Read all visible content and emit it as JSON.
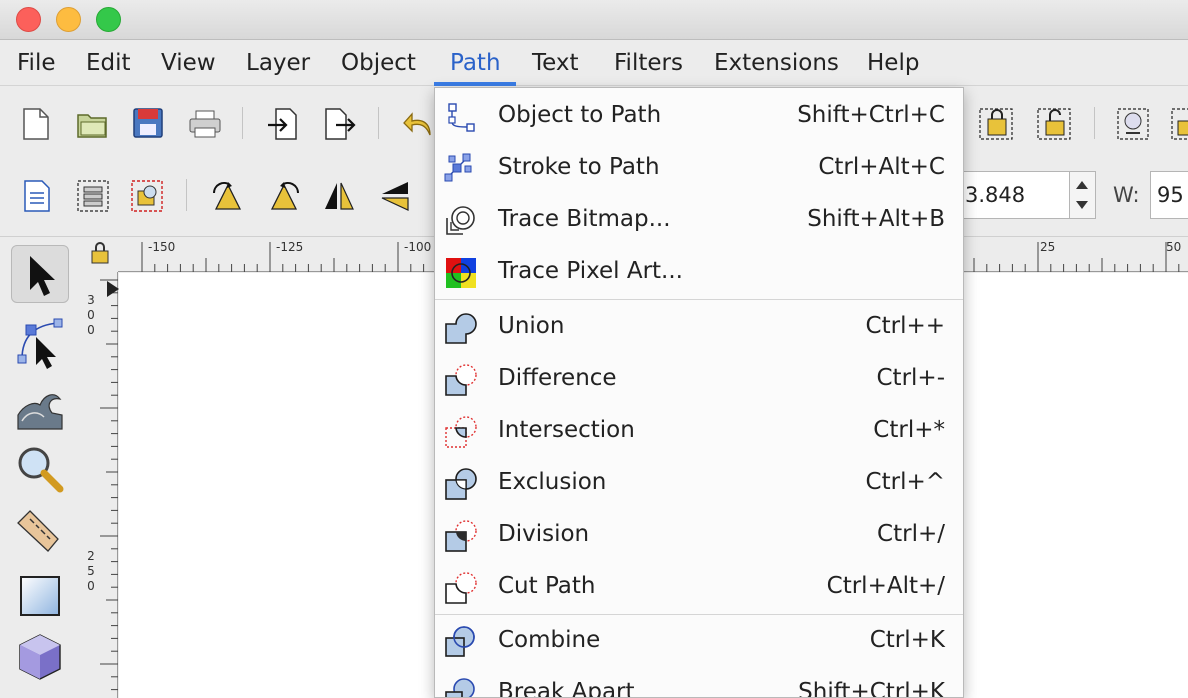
{
  "menubar": {
    "items": [
      "File",
      "Edit",
      "View",
      "Layer",
      "Object",
      "Path",
      "Text",
      "Filters",
      "Extensions",
      "Help"
    ],
    "active": "Path"
  },
  "toolbar": {
    "y_value": "3.848",
    "w_label": "W:",
    "w_value": "95"
  },
  "rulers": {
    "horizontal": [
      "-150",
      "-125",
      "-100",
      "25",
      "50"
    ],
    "vertical": [
      [
        "3",
        "0",
        "0"
      ],
      [
        "2",
        "5",
        "0"
      ]
    ]
  },
  "path_menu": {
    "groups": [
      [
        {
          "label": "Object to Path",
          "shortcut": "Shift+Ctrl+C",
          "icon": "object-to-path-icon"
        },
        {
          "label": "Stroke to Path",
          "shortcut": "Ctrl+Alt+C",
          "icon": "stroke-to-path-icon"
        },
        {
          "label": "Trace Bitmap...",
          "shortcut": "Shift+Alt+B",
          "icon": "trace-bitmap-icon"
        },
        {
          "label": "Trace Pixel Art...",
          "shortcut": "",
          "icon": "trace-pixel-art-icon"
        }
      ],
      [
        {
          "label": "Union",
          "shortcut": "Ctrl++",
          "icon": "union-icon"
        },
        {
          "label": "Difference",
          "shortcut": "Ctrl+-",
          "icon": "difference-icon"
        },
        {
          "label": "Intersection",
          "shortcut": "Ctrl+*",
          "icon": "intersection-icon"
        },
        {
          "label": "Exclusion",
          "shortcut": "Ctrl+^",
          "icon": "exclusion-icon"
        },
        {
          "label": "Division",
          "shortcut": "Ctrl+/",
          "icon": "division-icon"
        },
        {
          "label": "Cut Path",
          "shortcut": "Ctrl+Alt+/",
          "icon": "cut-path-icon"
        }
      ],
      [
        {
          "label": "Combine",
          "shortcut": "Ctrl+K",
          "icon": "combine-icon"
        },
        {
          "label": "Break Apart",
          "shortcut": "Shift+Ctrl+K",
          "icon": "break-apart-icon"
        }
      ]
    ]
  },
  "colors": {
    "accent": "#3b7ee8",
    "menu_active_text": "#2a62c9",
    "shape_fill": "#b4cbe6",
    "shape_stroke": "#1d1d1d",
    "cut_stroke": "#e03030"
  }
}
